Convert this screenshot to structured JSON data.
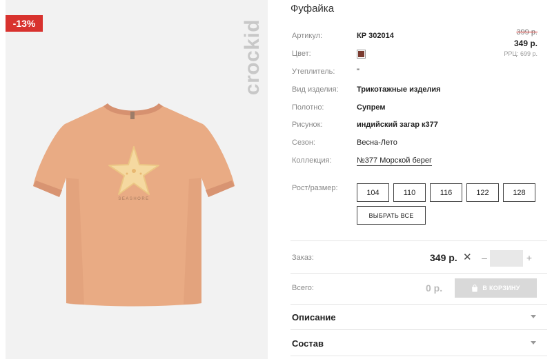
{
  "image": {
    "discount_badge": "-13%",
    "brand_logo": "crockid",
    "print_text": "SEASHORE"
  },
  "product": {
    "title": "Фуфайка",
    "attributes": [
      {
        "label": "Артикул:",
        "value": "КР 302014"
      },
      {
        "label": "Цвет:",
        "value": ""
      },
      {
        "label": "Утеплитель:",
        "value": "\""
      },
      {
        "label": "Вид изделия:",
        "value": "Трикотажные изделия"
      },
      {
        "label": "Полотно:",
        "value": "Супрем"
      },
      {
        "label": "Рисунок:",
        "value": "индийский загар к377"
      },
      {
        "label": "Сезон:",
        "value": "Весна-Лето"
      },
      {
        "label": "Коллекция:",
        "value": "№377 Морской берег"
      }
    ],
    "color_swatch": "#7a3b30"
  },
  "price": {
    "old": "399 р.",
    "new": "349 р.",
    "rrp": "РРЦ: 699 р."
  },
  "sizes": {
    "label": "Рост/размер:",
    "options": [
      "104",
      "110",
      "116",
      "122",
      "128"
    ],
    "select_all": "ВЫБРАТЬ ВСЕ"
  },
  "order": {
    "label": "Заказ:",
    "price": "349 р.",
    "times": "✕",
    "minus": "–",
    "plus": "+",
    "quantity": ""
  },
  "total": {
    "label": "Всего:",
    "value": "0 р.",
    "cart_button": "В КОРЗИНУ"
  },
  "accordion": [
    {
      "title": "Описание"
    },
    {
      "title": "Состав"
    }
  ],
  "colors": {
    "badge_red": "#d8322e",
    "shirt": "#e9ab84",
    "star": "#f5d9a0",
    "cart_disabled": "#d9d9d9"
  }
}
